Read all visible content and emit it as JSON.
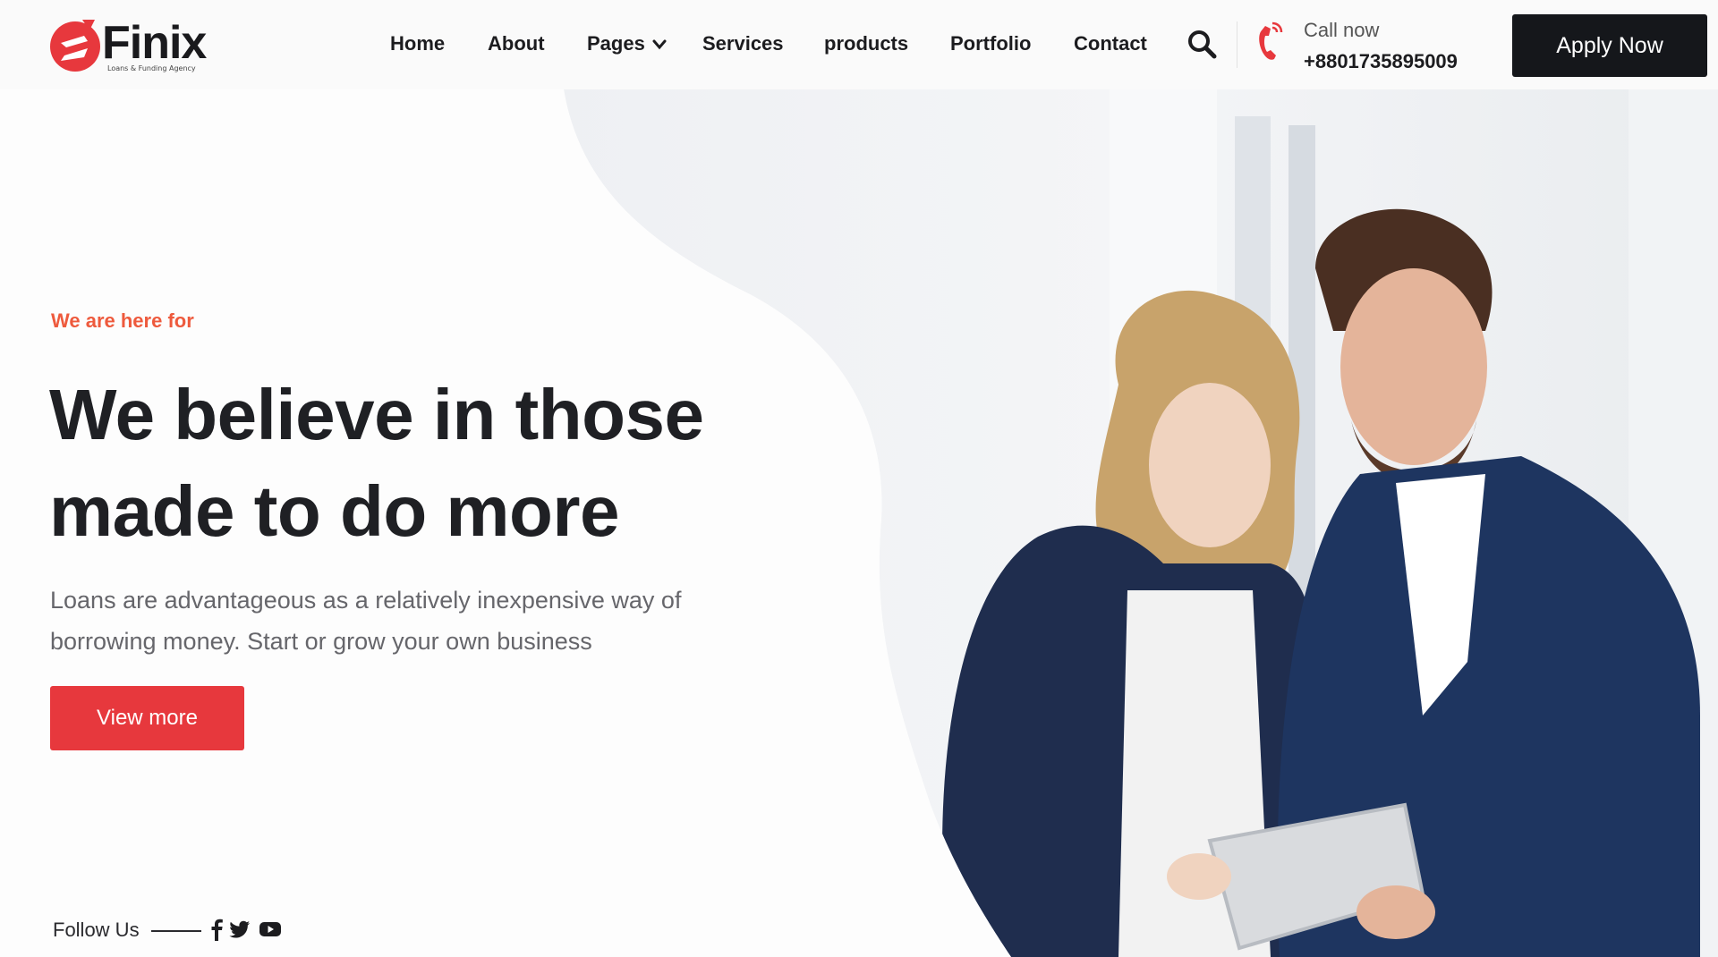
{
  "brand": {
    "name": "Finix",
    "tagline": "Loans & Funding Agency",
    "accent_color": "#e7383d",
    "eyebrow_color": "#ee5a3d",
    "dark_color": "#15171b"
  },
  "nav": {
    "items": [
      {
        "label": "Home"
      },
      {
        "label": "About"
      },
      {
        "label": "Pages",
        "has_dropdown": true
      },
      {
        "label": "Services"
      },
      {
        "label": "products"
      },
      {
        "label": "Portfolio"
      },
      {
        "label": "Contact"
      }
    ],
    "search_icon": "search-icon"
  },
  "contact": {
    "label": "Call now",
    "phone": "+8801735895009",
    "icon": "phone-icon"
  },
  "cta": {
    "apply_label": "Apply Now"
  },
  "hero": {
    "eyebrow": "We are here for",
    "headline_line1": "We believe in those",
    "headline_line2": "made to do more",
    "lede": "Loans are advantageous as a relatively inexpensive way of borrowing money. Start or grow your own business",
    "button_label": "View more",
    "image": "business-people-tablet-photo"
  },
  "follow": {
    "label": "Follow Us",
    "networks": [
      "facebook-icon",
      "twitter-icon",
      "youtube-icon"
    ]
  }
}
